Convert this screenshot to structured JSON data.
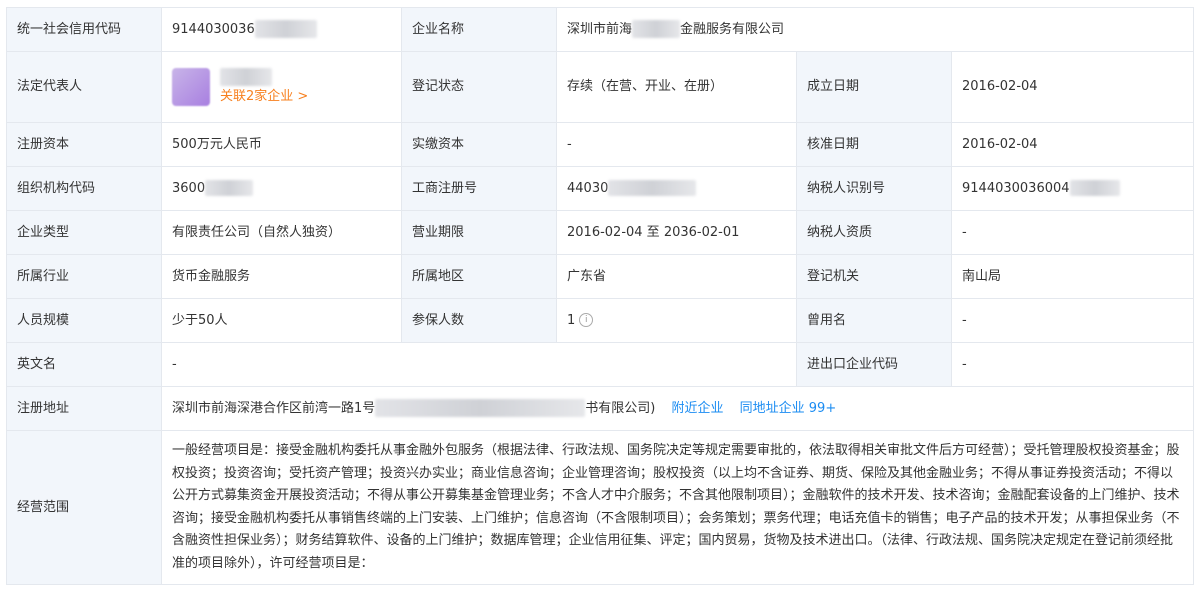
{
  "rows": {
    "credit_code": {
      "label": "统一社会信用代码",
      "value": "9144030036"
    },
    "company_name": {
      "label": "企业名称",
      "value_prefix": "深圳市前海",
      "value_suffix": "金融服务有限公司"
    },
    "legal_rep": {
      "label": "法定代表人",
      "link": "关联2家企业 >"
    },
    "status": {
      "label": "登记状态",
      "value": "存续（在营、开业、在册）"
    },
    "established": {
      "label": "成立日期",
      "value": "2016-02-04"
    },
    "reg_capital": {
      "label": "注册资本",
      "value": "500万元人民币"
    },
    "paid_capital": {
      "label": "实缴资本",
      "value": "-"
    },
    "approval_date": {
      "label": "核准日期",
      "value": "2016-02-04"
    },
    "org_code": {
      "label": "组织机构代码",
      "value": "3600"
    },
    "reg_no": {
      "label": "工商注册号",
      "value": "44030"
    },
    "taxpayer_id": {
      "label": "纳税人识别号",
      "value": "9144030036004"
    },
    "company_type": {
      "label": "企业类型",
      "value": "有限责任公司（自然人独资）"
    },
    "term": {
      "label": "营业期限",
      "value": "2016-02-04 至 2036-02-01"
    },
    "taxpayer_qual": {
      "label": "纳税人资质",
      "value": "-"
    },
    "industry": {
      "label": "所属行业",
      "value": "货币金融服务"
    },
    "region": {
      "label": "所属地区",
      "value": "广东省"
    },
    "reg_authority": {
      "label": "登记机关",
      "value": "南山局"
    },
    "staff_size": {
      "label": "人员规模",
      "value": "少于50人"
    },
    "insured": {
      "label": "参保人数",
      "value": "1"
    },
    "former_name": {
      "label": "曾用名",
      "value": "-"
    },
    "english_name": {
      "label": "英文名",
      "value": "-"
    },
    "import_export": {
      "label": "进出口企业代码",
      "value": "-"
    },
    "address": {
      "label": "注册地址",
      "value_prefix": "深圳市前海深港合作区前湾一路1号",
      "value_suffix": "书有限公司)",
      "nearby_link": "附近企业",
      "same_addr_link": "同地址企业 99+"
    },
    "scope": {
      "label": "经营范围",
      "value": "一般经营项目是：接受金融机构委托从事金融外包服务（根据法律、行政法规、国务院决定等规定需要审批的，依法取得相关审批文件后方可经营）；受托管理股权投资基金；股权投资；投资咨询；受托资产管理；投资兴办实业；商业信息咨询；企业管理咨询；股权投资（以上均不含证券、期货、保险及其他金融业务；不得从事证券投资活动；不得以公开方式募集资金开展投资活动；不得从事公开募集基金管理业务；不含人才中介服务；不含其他限制项目）；金融软件的技术开发、技术咨询；金融配套设备的上门维护、技术咨询；接受金融机构委托从事销售终端的上门安装、上门维护；信息咨询（不含限制项目）；会务策划；票务代理；电话充值卡的销售；电子产品的技术开发；从事担保业务（不含融资性担保业务）；财务结算软件、设备的上门维护；数据库管理；企业信用征集、评定；国内贸易，货物及技术进出口。（法律、行政法规、国务院决定规定在登记前须经批准的项目除外），许可经营项目是："
    }
  },
  "colors": {
    "label_bg": "#f2f6fb",
    "border": "#e4e8ee",
    "link_orange": "#f7801f",
    "link_blue": "#1b8cf2"
  },
  "icons": {
    "insured_info": "info-circle-icon"
  }
}
